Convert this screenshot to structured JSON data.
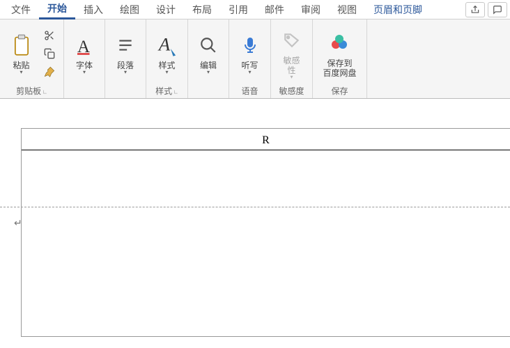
{
  "tabs": {
    "file": "文件",
    "home": "开始",
    "insert": "插入",
    "draw": "绘图",
    "design": "设计",
    "layout": "布局",
    "references": "引用",
    "mailings": "邮件",
    "review": "审阅",
    "view": "视图",
    "header_footer": "页眉和页脚"
  },
  "ribbon": {
    "clipboard": {
      "paste": "粘贴",
      "group": "剪贴板"
    },
    "font": {
      "big": "字体"
    },
    "paragraph": {
      "big": "段落"
    },
    "styles": {
      "big": "样式",
      "group": "样式"
    },
    "editing": {
      "big": "编辑"
    },
    "voice": {
      "big": "听写",
      "group": "语音"
    },
    "sensitivity": {
      "big": "敏感\n性",
      "group": "敏感度"
    },
    "save": {
      "big": "保存到\n百度网盘",
      "group": "保存"
    }
  },
  "doc": {
    "header_text": "R",
    "para_mark": "↵"
  }
}
